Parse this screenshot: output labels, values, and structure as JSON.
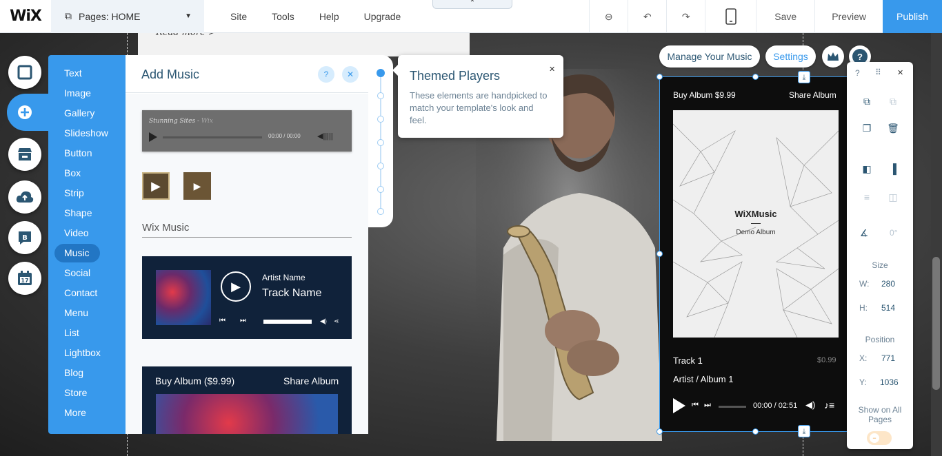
{
  "topbar": {
    "logo": "WiX",
    "pages_label": "Pages: HOME",
    "menu": [
      "Site",
      "Tools",
      "Help",
      "Upgrade"
    ],
    "save": "Save",
    "preview": "Preview",
    "publish": "Publish"
  },
  "canvas": {
    "read_more": "Read more >"
  },
  "add_menu": {
    "items": [
      "Text",
      "Image",
      "Gallery",
      "Slideshow",
      "Button",
      "Box",
      "Strip",
      "Shape",
      "Video",
      "Music",
      "Social",
      "Contact",
      "Menu",
      "List",
      "Lightbox",
      "Blog",
      "Store",
      "More"
    ],
    "selected": "Music"
  },
  "panel": {
    "title": "Add Music",
    "help": "?",
    "close": "✕",
    "mini_player": {
      "artist": "Stunning Sites",
      "sep": " - ",
      "label": "Wix",
      "time": "00:00 / 00:00"
    },
    "wix_music_label": "Wix Music",
    "wm_player": {
      "artist": "Artist Name",
      "track": "Track Name"
    },
    "album_player": {
      "buy": "Buy Album ($9.99)",
      "share": "Share Album"
    }
  },
  "tooltip": {
    "title": "Themed Players",
    "body": "These elements are handpicked to match your template's look and feel.",
    "close": "✕"
  },
  "widget_actions": {
    "manage": "Manage Your Music",
    "settings": "Settings",
    "help": "?"
  },
  "widget": {
    "buy": "Buy Album $9.99",
    "share": "Share Album",
    "brand": "WiXMusic",
    "album": "Demo Album",
    "track": "Track 1",
    "price": "$0.99",
    "artist_album": "Artist / Album 1",
    "time": "00:00 / 02:51"
  },
  "tools": {
    "help": "?",
    "close": "✕",
    "rotation": "0°",
    "size_label": "Size",
    "w_label": "W:",
    "w": "280",
    "h_label": "H:",
    "h": "514",
    "position_label": "Position",
    "x_label": "X:",
    "x": "771",
    "y_label": "Y:",
    "y": "1036",
    "show_all": "Show on All Pages"
  },
  "colors": {
    "accent": "#3899ec",
    "panel_title": "#2b5672",
    "player_bg": "#10223a"
  }
}
